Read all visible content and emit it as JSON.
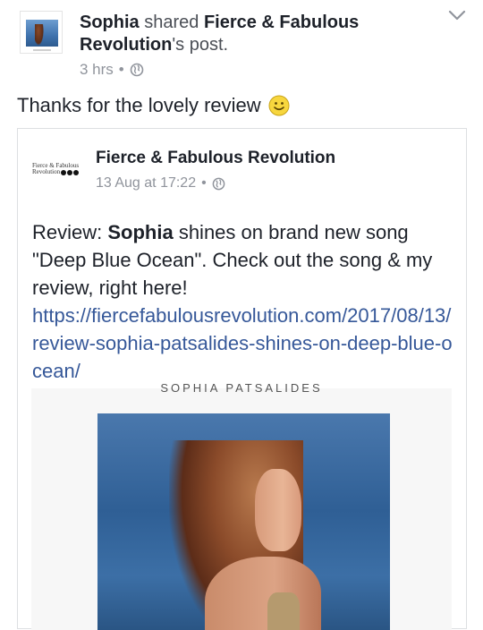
{
  "header": {
    "actor": "Sophia",
    "verb": " shared ",
    "page": "Fierce & Fabulous Revolution",
    "suffix": "'s post.",
    "time": "3 hrs",
    "privacy_icon": "globe-icon",
    "menu_icon": "chevron-down-icon"
  },
  "status": {
    "text": "Thanks for the lovely review",
    "emoji": "smiley-icon"
  },
  "shared_post": {
    "logo_line1": "Fierce & Fabulous",
    "logo_line2": "Revolution",
    "page_name": "Fierce & Fabulous Revolution",
    "time": "13 Aug at 17:22",
    "text_prefix": "Review: ",
    "text_bold": "Sophia",
    "text_rest": " shines on brand new song \"Deep Blue Ocean\". Check out the song & my review, right here!",
    "link": "https://fiercefabulousrevolution.com/2017/08/13/review-sophia-patsalides-shines-on-deep-blue-ocean/",
    "image_caption": "SOPHIA PATSALIDES"
  },
  "colors": {
    "link": "#365899",
    "secondary_text": "#90949c",
    "border": "#dddfe2"
  }
}
